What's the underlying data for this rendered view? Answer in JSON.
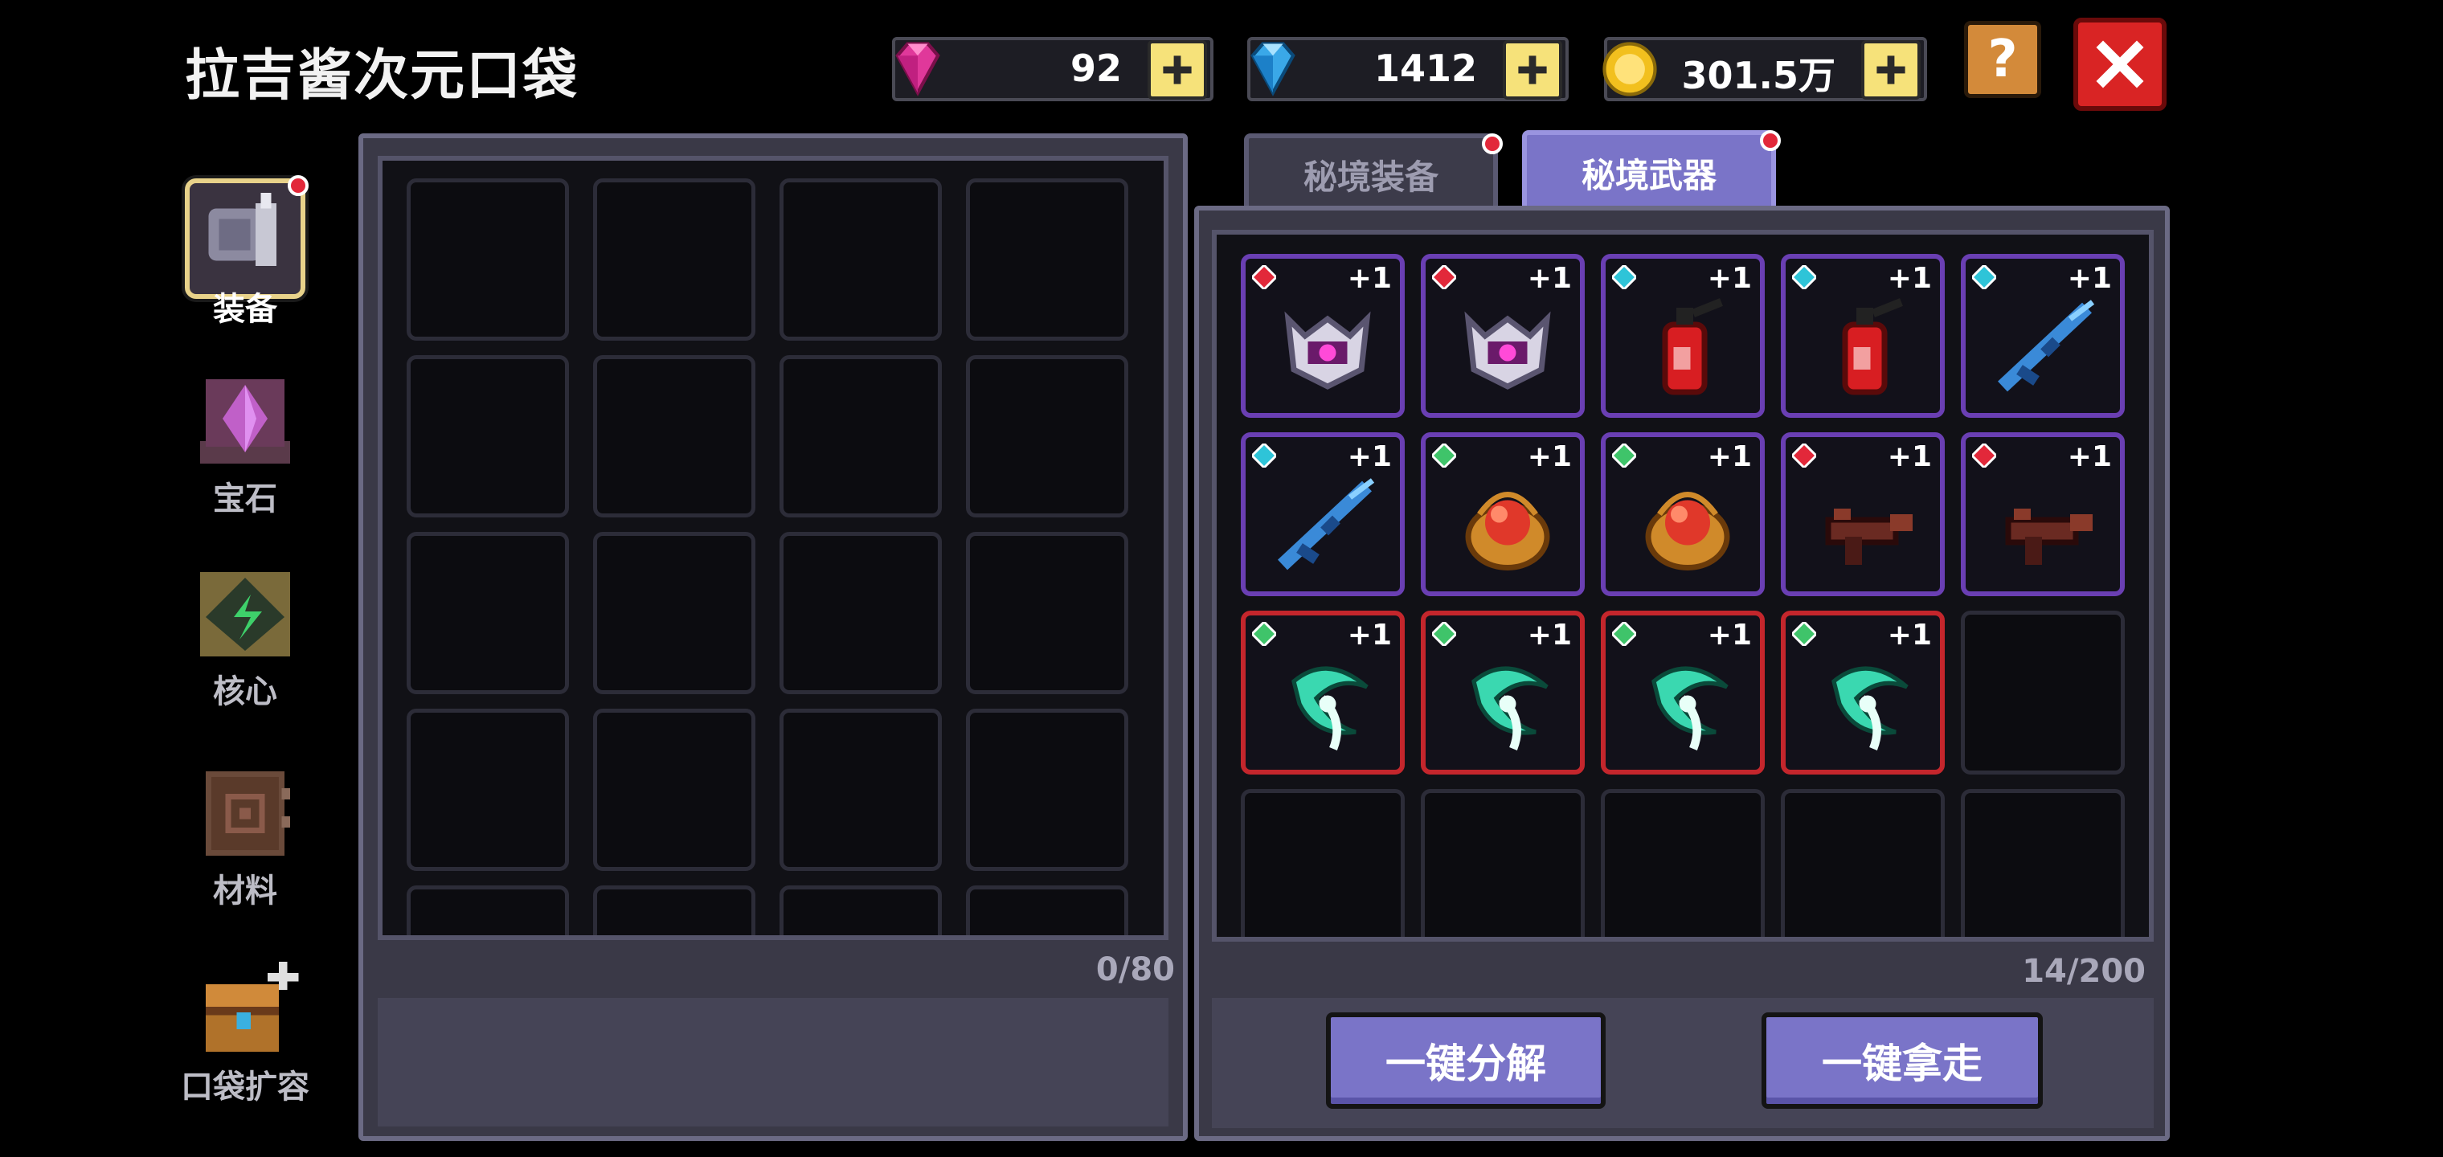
{
  "header": {
    "title": "拉吉酱次元口袋",
    "currencies": [
      {
        "name": "pink-gem",
        "value": "92",
        "color": "#e0389a"
      },
      {
        "name": "blue-gem",
        "value": "1412",
        "color": "#3aa8e8"
      },
      {
        "name": "gold-coin",
        "value": "301.5万",
        "color": "#f2c01e"
      }
    ],
    "help_label": "?",
    "close_icon": "close-icon"
  },
  "sidebar": {
    "items": [
      {
        "label": "装备",
        "icon": "armor-icon",
        "active": true,
        "badge": true
      },
      {
        "label": "宝石",
        "icon": "gem-icon",
        "active": false,
        "badge": false
      },
      {
        "label": "核心",
        "icon": "core-icon",
        "active": false,
        "badge": false
      },
      {
        "label": "材料",
        "icon": "material-icon",
        "active": false,
        "badge": false
      },
      {
        "label": "口袋扩容",
        "icon": "chest-icon",
        "active": false,
        "badge": false
      }
    ]
  },
  "left_panel": {
    "count": "0/80"
  },
  "right_panel": {
    "tabs": [
      {
        "label": "秘境装备",
        "active": false,
        "badge": true
      },
      {
        "label": "秘境武器",
        "active": true,
        "badge": true
      }
    ],
    "count": "14/200",
    "items": [
      {
        "icon": "helmet-icon",
        "level": "+1",
        "frame": "purple",
        "gem": "#e2283a"
      },
      {
        "icon": "helmet-icon",
        "level": "+1",
        "frame": "purple",
        "gem": "#e2283a"
      },
      {
        "icon": "fire-extinguisher-icon",
        "level": "+1",
        "frame": "purple",
        "gem": "#2ec4d8"
      },
      {
        "icon": "fire-extinguisher-icon",
        "level": "+1",
        "frame": "purple",
        "gem": "#2ec4d8"
      },
      {
        "icon": "rifle-icon",
        "level": "+1",
        "frame": "purple",
        "gem": "#2ec4d8"
      },
      {
        "icon": "rifle-icon",
        "level": "+1",
        "frame": "purple",
        "gem": "#2ec4d8"
      },
      {
        "icon": "basket-icon",
        "level": "+1",
        "frame": "purple",
        "gem": "#3fc46a"
      },
      {
        "icon": "basket-icon",
        "level": "+1",
        "frame": "purple",
        "gem": "#3fc46a"
      },
      {
        "icon": "gun-icon",
        "level": "+1",
        "frame": "purple",
        "gem": "#e2283a"
      },
      {
        "icon": "gun-icon",
        "level": "+1",
        "frame": "purple",
        "gem": "#e2283a"
      },
      {
        "icon": "scythe-icon",
        "level": "+1",
        "frame": "red",
        "gem": "#3fc46a"
      },
      {
        "icon": "scythe-icon",
        "level": "+1",
        "frame": "red",
        "gem": "#3fc46a"
      },
      {
        "icon": "scythe-icon",
        "level": "+1",
        "frame": "red",
        "gem": "#3fc46a"
      },
      {
        "icon": "scythe-icon",
        "level": "+1",
        "frame": "red",
        "gem": "#3fc46a"
      }
    ],
    "buttons": {
      "decompose": "一键分解",
      "take_all": "一键拿走"
    }
  }
}
